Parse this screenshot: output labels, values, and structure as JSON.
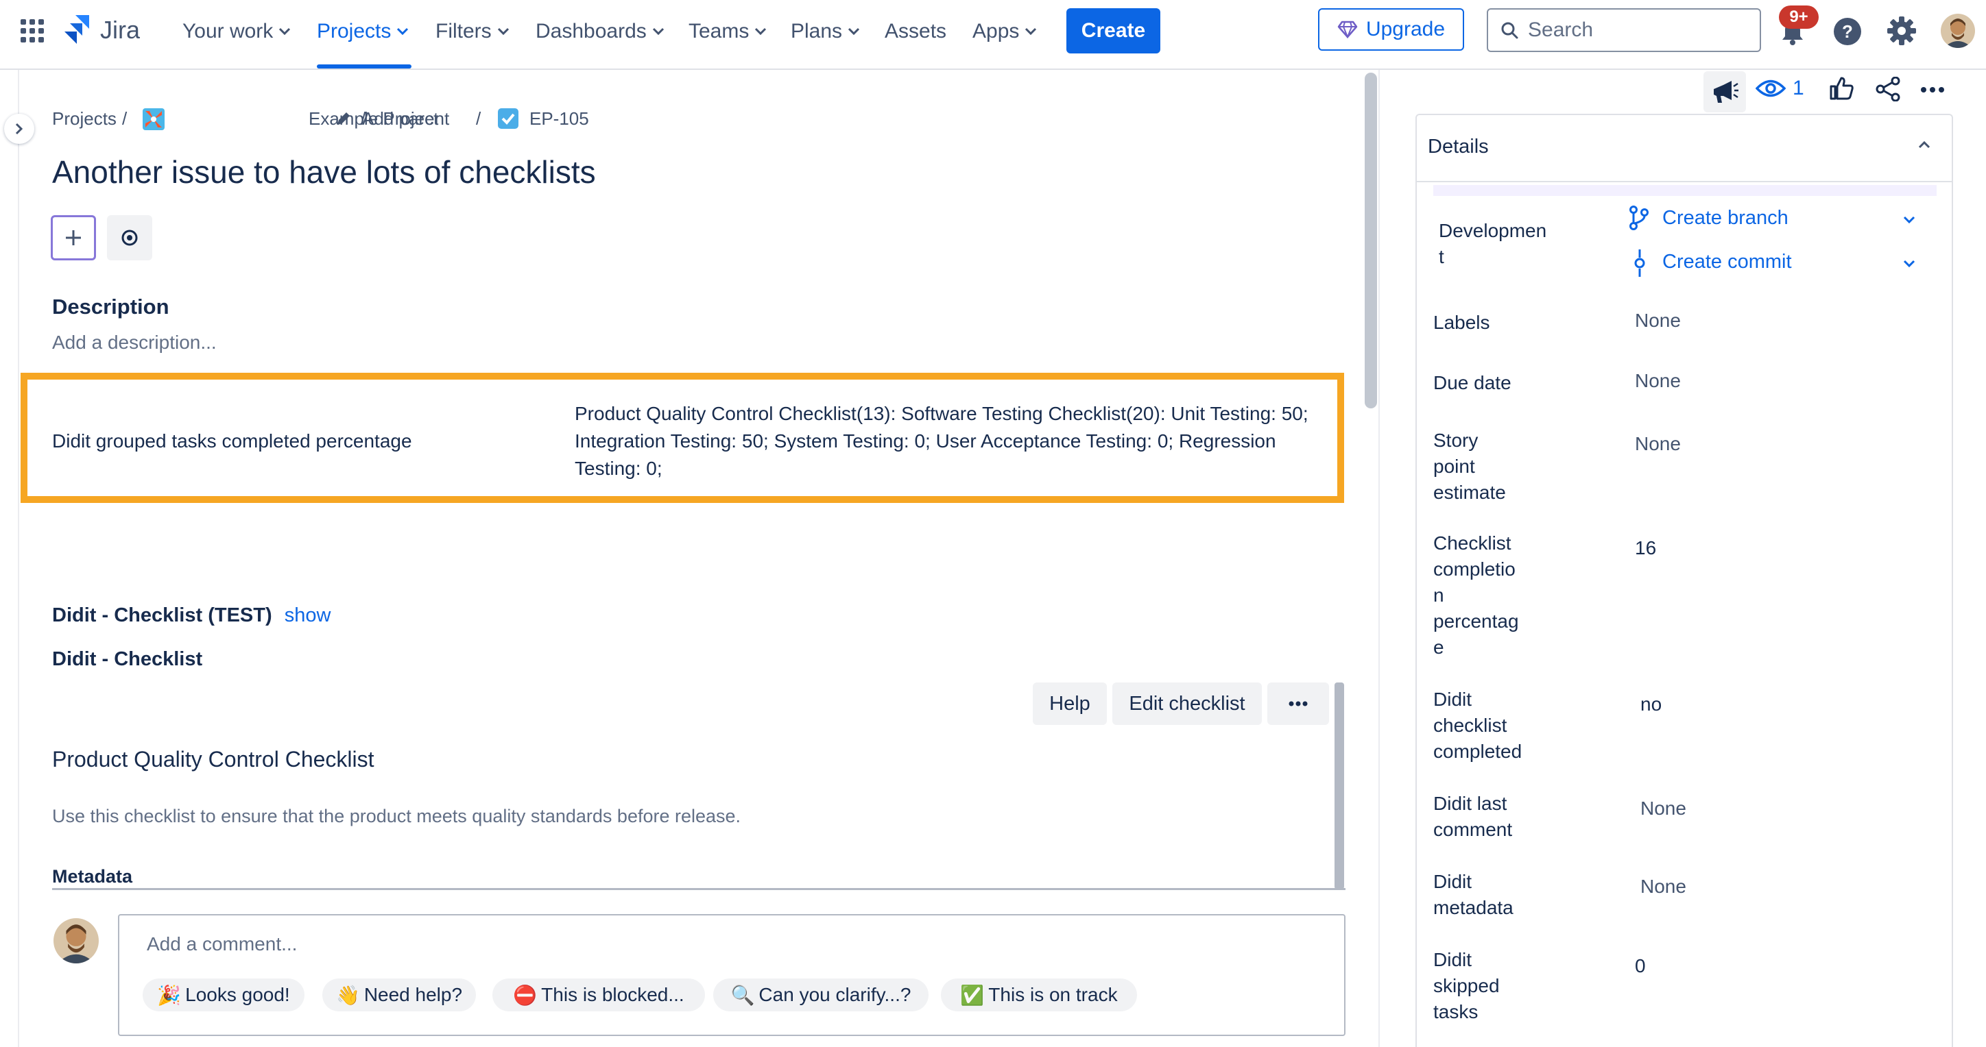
{
  "nav": {
    "product": "Jira",
    "items": [
      {
        "label": "Your work",
        "has_dropdown": true
      },
      {
        "label": "Projects",
        "has_dropdown": true,
        "active": true
      },
      {
        "label": "Filters",
        "has_dropdown": true
      },
      {
        "label": "Dashboards",
        "has_dropdown": true
      },
      {
        "label": "Teams",
        "has_dropdown": true
      },
      {
        "label": "Plans",
        "has_dropdown": true
      },
      {
        "label": "Assets",
        "has_dropdown": false
      },
      {
        "label": "Apps",
        "has_dropdown": true
      }
    ],
    "create_label": "Create",
    "upgrade_label": "Upgrade",
    "search_placeholder": "Search",
    "notifications_badge": "9+",
    "colors": {
      "accent": "#0c66e4",
      "badge": "#c9372c"
    }
  },
  "breadcrumb": {
    "projects": "Projects",
    "project": "Example Project",
    "add_parent": "Add parent",
    "issue_key": "EP-105"
  },
  "issue": {
    "title": "Another issue to have lots of checklists"
  },
  "description": {
    "heading": "Description",
    "placeholder": "Add a description..."
  },
  "highlighted_field": {
    "label": "Didit grouped tasks completed percentage",
    "value": "Product Quality Control Checklist(13): Software Testing Checklist(20): Unit Testing: 50; Integration Testing: 50; System Testing: 0; User Acceptance Testing: 0; Regression Testing: 0;",
    "highlight_color": "#f6a623"
  },
  "checklist_test": {
    "heading": "Didit - Checklist (TEST)",
    "toggle": "show"
  },
  "checklist": {
    "heading": "Didit - Checklist",
    "toolbar": {
      "help": "Help",
      "edit": "Edit checklist"
    },
    "title": "Product Quality Control Checklist",
    "description": "Use this checklist to ensure that the product meets quality standards before release.",
    "metadata_heading": "Metadata"
  },
  "comment": {
    "placeholder": "Add a comment...",
    "quick_replies": [
      {
        "emoji": "🎉",
        "label": "Looks good!"
      },
      {
        "emoji": "👋",
        "label": "Need help?"
      },
      {
        "emoji": "⛔",
        "label": "This is blocked..."
      },
      {
        "emoji": "🔍",
        "label": "Can you clarify...?"
      },
      {
        "emoji": "✅",
        "label": "This is on track"
      }
    ]
  },
  "toolbar_right": {
    "watchers": "1"
  },
  "details": {
    "title": "Details",
    "development": {
      "label": "Developmen\nt",
      "create_branch": "Create branch",
      "create_commit": "Create commit"
    },
    "fields": [
      {
        "label": "Labels",
        "value": "None"
      },
      {
        "label": "Due date",
        "value": "None"
      },
      {
        "label": "Story\npoint\nestimate",
        "value": "None"
      },
      {
        "label": "Checklist\ncompletio\nn\npercentag\ne",
        "value": "16"
      },
      {
        "label": "Didit\nchecklist\ncompleted",
        "value": "no"
      },
      {
        "label": "Didit last\ncomment",
        "value": "None"
      },
      {
        "label": "Didit\nmetadata",
        "value": "None"
      },
      {
        "label": "Didit\nskipped\ntasks",
        "value": "0"
      }
    ]
  }
}
